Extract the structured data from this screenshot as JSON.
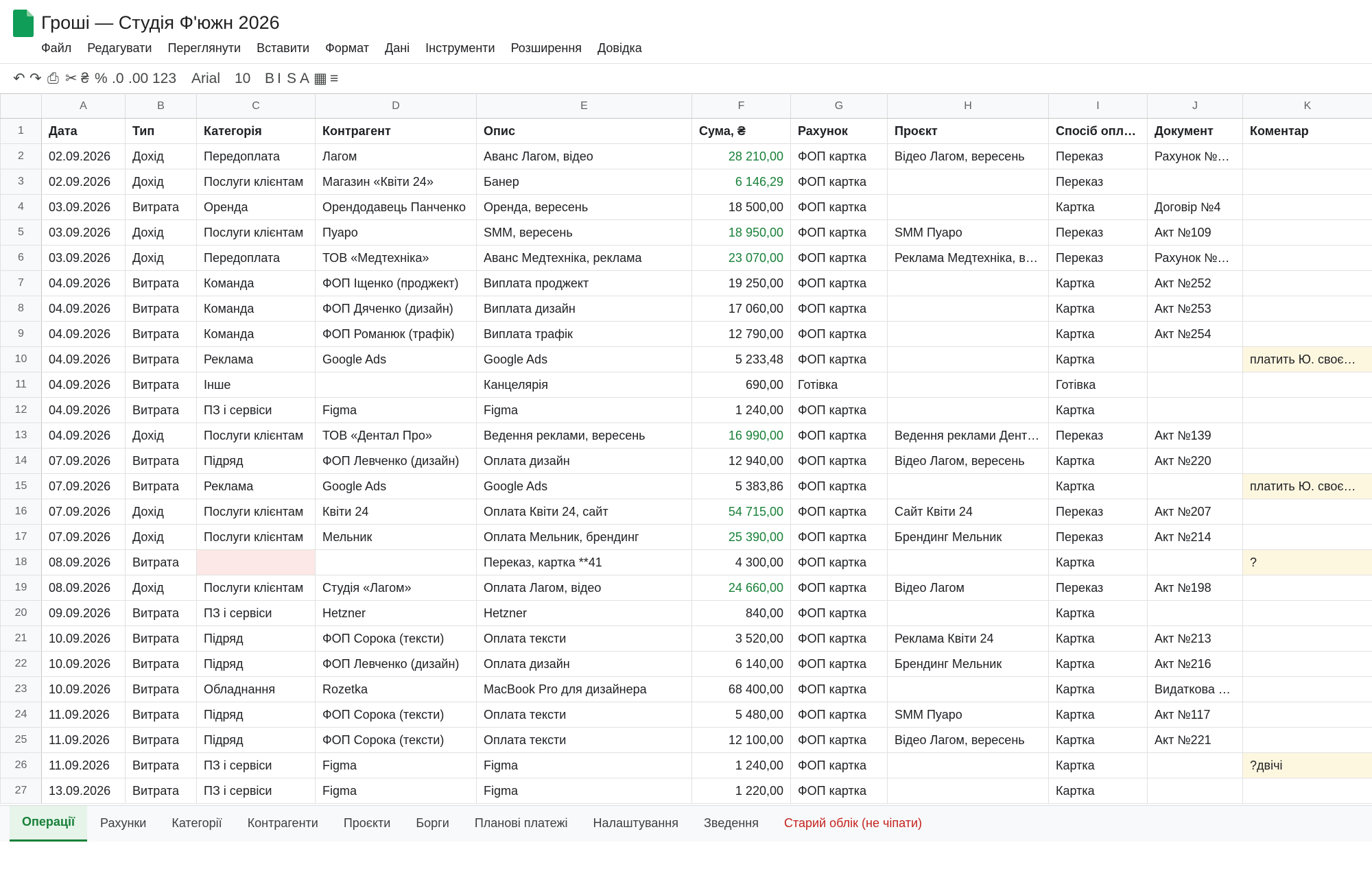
{
  "document": {
    "title": "Гроші — Студія Ф'южн 2026",
    "menu": [
      "Файл",
      "Редагувати",
      "Переглянути",
      "Вставити",
      "Формат",
      "Дані",
      "Інструменти",
      "Розширення",
      "Довідка"
    ]
  },
  "toolbar": {
    "undo": "↶",
    "redo": "↷",
    "print": "⎙",
    "paint_format": "✂",
    "format_currency": "₴",
    "format_percent": "%",
    "decrease_decimal": ".0",
    "increase_decimal": ".00",
    "more_formats": "123",
    "font": "Arial",
    "font_size": "10",
    "bold": "B",
    "italic": "I",
    "strikethrough": "S",
    "text_color": "A",
    "borders": "▦",
    "align": "≡"
  },
  "grid": {
    "columns": [
      "A",
      "B",
      "C",
      "D",
      "E",
      "F",
      "G",
      "H",
      "I",
      "J",
      "K"
    ],
    "headers": [
      "Дата",
      "Тип",
      "Категорія",
      "Контрагент",
      "Опис",
      "Сума, ₴",
      "Рахунок",
      "Проєкт",
      "Спосіб оплати",
      "Документ",
      "Коментар"
    ],
    "rows": [
      [
        "02.09.2026",
        "Дохід",
        "Передоплата",
        "Лагом",
        "Аванс Лагом, відео",
        "28 210,00",
        "ФОП картка",
        "Відео Лагом, вересень",
        "Переказ",
        "Рахунок №…",
        ""
      ],
      [
        "02.09.2026",
        "Дохід",
        "Послуги клієнтам",
        "Магазин «Квіти 24»",
        "Банер",
        "6 146,29",
        "ФОП картка",
        "",
        "Переказ",
        "",
        ""
      ],
      [
        "03.09.2026",
        "Витрата",
        "Оренда",
        "Орендодавець Панченко",
        "Оренда, вересень",
        "18 500,00",
        "ФОП картка",
        "",
        "Картка",
        "Договір №4",
        ""
      ],
      [
        "03.09.2026",
        "Дохід",
        "Послуги клієнтам",
        "Пуаро",
        "SMM, вересень",
        "18 950,00",
        "ФОП картка",
        "SMM Пуаро",
        "Переказ",
        "Акт №109",
        ""
      ],
      [
        "03.09.2026",
        "Дохід",
        "Передоплата",
        "ТОВ «Медтехніка»",
        "Аванс Медтехніка, реклама",
        "23 070,00",
        "ФОП картка",
        "Реклама Медтехніка, в…",
        "Переказ",
        "Рахунок №…",
        ""
      ],
      [
        "04.09.2026",
        "Витрата",
        "Команда",
        "ФОП Іщенко (проджект)",
        "Виплата проджект",
        "19 250,00",
        "ФОП картка",
        "",
        "Картка",
        "Акт №252",
        ""
      ],
      [
        "04.09.2026",
        "Витрата",
        "Команда",
        "ФОП Дяченко (дизайн)",
        "Виплата дизайн",
        "17 060,00",
        "ФОП картка",
        "",
        "Картка",
        "Акт №253",
        ""
      ],
      [
        "04.09.2026",
        "Витрата",
        "Команда",
        "ФОП Романюк (трафік)",
        "Виплата трафік",
        "12 790,00",
        "ФОП картка",
        "",
        "Картка",
        "Акт №254",
        ""
      ],
      [
        "04.09.2026",
        "Витрата",
        "Реклама",
        "Google Ads",
        "Google Ads",
        "5 233,48",
        "ФОП картка",
        "",
        "Картка",
        "",
        "платить Ю. своєю…"
      ],
      [
        "04.09.2026",
        "Витрата",
        "Інше",
        "",
        "Канцелярія",
        "690,00",
        "Готівка",
        "",
        "Готівка",
        "",
        ""
      ],
      [
        "04.09.2026",
        "Витрата",
        "ПЗ і сервіси",
        "Figma",
        "Figma",
        "1 240,00",
        "ФОП картка",
        "",
        "Картка",
        "",
        ""
      ],
      [
        "04.09.2026",
        "Дохід",
        "Послуги клієнтам",
        "ТОВ «Дентал Про»",
        "Ведення реклами, вересень",
        "16 990,00",
        "ФОП картка",
        "Ведення реклами Дент…",
        "Переказ",
        "Акт №139",
        ""
      ],
      [
        "07.09.2026",
        "Витрата",
        "Підряд",
        "ФОП Левченко (дизайн)",
        "Оплата дизайн",
        "12 940,00",
        "ФОП картка",
        "Відео Лагом, вересень",
        "Картка",
        "Акт №220",
        ""
      ],
      [
        "07.09.2026",
        "Витрата",
        "Реклама",
        "Google Ads",
        "Google Ads",
        "5 383,86",
        "ФОП картка",
        "",
        "Картка",
        "",
        "платить Ю. своєю…"
      ],
      [
        "07.09.2026",
        "Дохід",
        "Послуги клієнтам",
        "Квіти 24",
        "Оплата Квіти 24, сайт",
        "54 715,00",
        "ФОП картка",
        "Сайт Квіти 24",
        "Переказ",
        "Акт №207",
        ""
      ],
      [
        "07.09.2026",
        "Дохід",
        "Послуги клієнтам",
        "Мельник",
        "Оплата Мельник, брендинг",
        "25 390,00",
        "ФОП картка",
        "Брендинг Мельник",
        "Переказ",
        "Акт №214",
        ""
      ],
      [
        "08.09.2026",
        "Витрата",
        "",
        "",
        "Переказ, картка **41",
        "4 300,00",
        "ФОП картка",
        "",
        "Картка",
        "",
        "?"
      ],
      [
        "08.09.2026",
        "Дохід",
        "Послуги клієнтам",
        "Студія «Лагом»",
        "Оплата Лагом, відео",
        "24 660,00",
        "ФОП картка",
        "Відео Лагом",
        "Переказ",
        "Акт №198",
        ""
      ],
      [
        "09.09.2026",
        "Витрата",
        "ПЗ і сервіси",
        "Hetzner",
        "Hetzner",
        "840,00",
        "ФОП картка",
        "",
        "Картка",
        "",
        ""
      ],
      [
        "10.09.2026",
        "Витрата",
        "Підряд",
        "ФОП Сорока (тексти)",
        "Оплата тексти",
        "3 520,00",
        "ФОП картка",
        "Реклама Квіти 24",
        "Картка",
        "Акт №213",
        ""
      ],
      [
        "10.09.2026",
        "Витрата",
        "Підряд",
        "ФОП Левченко (дизайн)",
        "Оплата дизайн",
        "6 140,00",
        "ФОП картка",
        "Брендинг Мельник",
        "Картка",
        "Акт №216",
        ""
      ],
      [
        "10.09.2026",
        "Витрата",
        "Обладнання",
        "Rozetka",
        "MacBook Pro для дизайнера",
        "68 400,00",
        "ФОП картка",
        "",
        "Картка",
        "Видаткова …",
        ""
      ],
      [
        "11.09.2026",
        "Витрата",
        "Підряд",
        "ФОП Сорока (тексти)",
        "Оплата тексти",
        "5 480,00",
        "ФОП картка",
        "SMM Пуаро",
        "Картка",
        "Акт №117",
        ""
      ],
      [
        "11.09.2026",
        "Витрата",
        "Підряд",
        "ФОП Сорока (тексти)",
        "Оплата тексти",
        "12 100,00",
        "ФОП картка",
        "Відео Лагом, вересень",
        "Картка",
        "Акт №221",
        ""
      ],
      [
        "11.09.2026",
        "Витрата",
        "ПЗ і сервіси",
        "Figma",
        "Figma",
        "1 240,00",
        "ФОП картка",
        "",
        "Картка",
        "",
        "?двічі"
      ],
      [
        "13.09.2026",
        "Витрата",
        "ПЗ і сервіси",
        "Figma",
        "Figma",
        "1 220,00",
        "ФОП картка",
        "",
        "Картка",
        "",
        ""
      ]
    ]
  },
  "sheet_tabs": [
    {
      "label": "Операції",
      "active": true
    },
    {
      "label": "Рахунки"
    },
    {
      "label": "Категорії"
    },
    {
      "label": "Контрагенти"
    },
    {
      "label": "Проєкти"
    },
    {
      "label": "Борги"
    },
    {
      "label": "Планові платежі"
    },
    {
      "label": "Налаштування"
    },
    {
      "label": "Зведення"
    },
    {
      "label": "Старий облік (не чіпати)",
      "danger": true
    }
  ],
  "colors": {
    "brand_green": "#0f9d58",
    "income_green": "#188038",
    "missing_category": "#fce8e6",
    "comment_highlight": "#fef7e0",
    "danger_tab": "#c5221f"
  }
}
